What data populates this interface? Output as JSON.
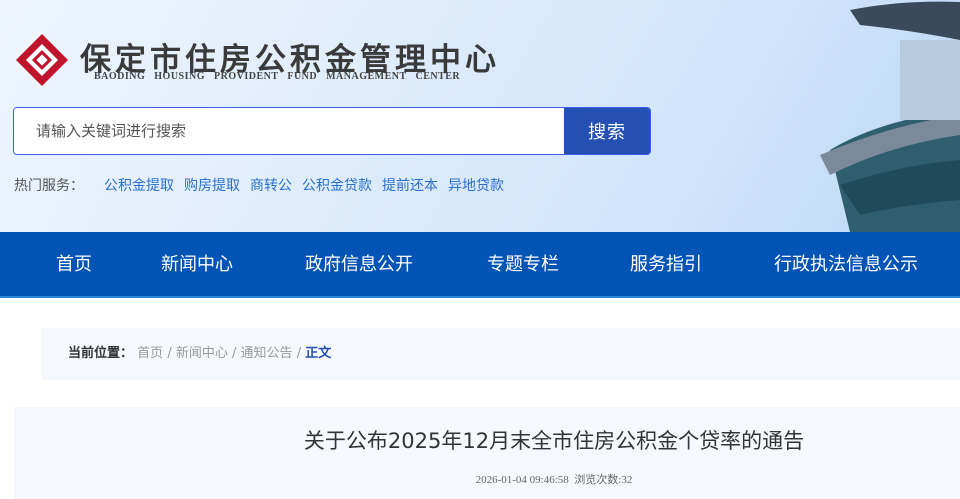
{
  "header": {
    "logo_cn": "保定市住房公积金管理中心",
    "logo_en": "BAODING HOUSING PROVIDENT FUND MANAGEMENT CENTER",
    "search_placeholder": "请输入关键词进行搜索",
    "search_button": "搜索",
    "hot_label": "热门服务：",
    "hot_links": [
      "公积金提取",
      "购房提取",
      "商转公",
      "公积金贷款",
      "提前还本",
      "异地贷款"
    ]
  },
  "nav": [
    "首页",
    "新闻中心",
    "政府信息公开",
    "专题专栏",
    "服务指引",
    "行政执法信息公示"
  ],
  "breadcrumb": {
    "label": "当前位置：",
    "items": [
      "首页",
      "新闻中心",
      "通知公告"
    ],
    "current": "正文",
    "sep": "/"
  },
  "article": {
    "title": "关于公布2025年12月末全市住房公积金个贷率的通告",
    "date": "2026-01-04 09:46:58",
    "views": "浏览次数:32"
  },
  "colors": {
    "brand": "#0354b5",
    "logo_red": "#c0142d",
    "link": "#2a6fcf"
  }
}
